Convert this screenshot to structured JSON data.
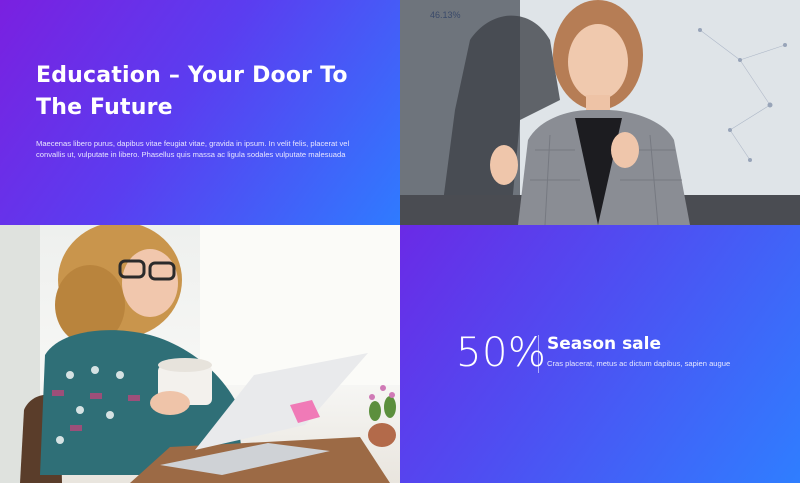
{
  "hero": {
    "title": "Education – Your Door To The Future",
    "body": "Maecenas libero purus, dapibus vitae feugiat vitae, gravida in ipsum. In velit felis, placerat vel convallis ut, vulputate in libero. Phasellus quis massa ac ligula sodales vulputate malesuada"
  },
  "video": {
    "screen_stat": "46.13%"
  },
  "promo": {
    "percent": "50%",
    "title": "Season sale",
    "subtitle": "Cras placerat, metus ac dictum dapibus, sapien augue"
  },
  "colors": {
    "gradient_start": "#7a20e0",
    "gradient_end": "#2f7bff",
    "text": "#ffffff"
  },
  "icons": {
    "play": "play-icon"
  }
}
